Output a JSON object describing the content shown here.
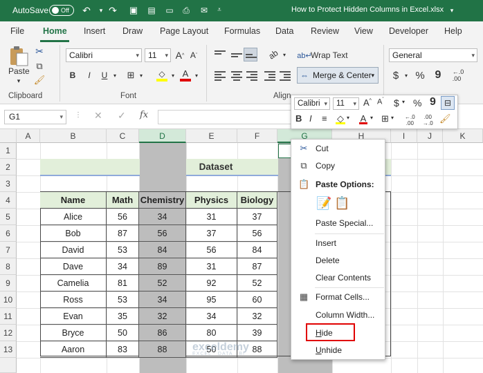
{
  "title_bar": {
    "autosave_label": "AutoSave",
    "autosave_state": "Off",
    "document_title": "How to Protect Hidden Columns in Excel.xlsx"
  },
  "menu_tabs": [
    "File",
    "Home",
    "Insert",
    "Draw",
    "Page Layout",
    "Formulas",
    "Data",
    "Review",
    "View",
    "Developer",
    "Help"
  ],
  "ribbon": {
    "paste_label": "Paste",
    "clipboard_group": "Clipboard",
    "font_group": "Font",
    "alignment_group": "Align",
    "font_name": "Calibri",
    "font_size": "11",
    "wrap_text": "Wrap Text",
    "merge_center": "Merge & Center",
    "number_format": "General",
    "bold": "B",
    "italic": "I",
    "underline": "U",
    "currency": "$",
    "percent": "%",
    "comma": "9"
  },
  "formula_bar": {
    "name_box": "G1",
    "fx": "fx"
  },
  "mini_toolbar": {
    "font_name": "Calibri",
    "font_size": "11"
  },
  "sheet": {
    "columns": [
      "A",
      "B",
      "C",
      "D",
      "E",
      "F",
      "G",
      "H",
      "I",
      "J",
      "K"
    ],
    "rows": [
      "1",
      "2",
      "3",
      "4",
      "5",
      "6",
      "7",
      "8",
      "9",
      "10",
      "11",
      "12",
      "13"
    ],
    "dataset_title": "Dataset",
    "headers": [
      "Name",
      "Math",
      "Chemistry",
      "Physics",
      "Biology"
    ],
    "records": [
      [
        "Alice",
        "56",
        "34",
        "31",
        "37"
      ],
      [
        "Bob",
        "87",
        "56",
        "37",
        "56"
      ],
      [
        "David",
        "53",
        "84",
        "56",
        "84"
      ],
      [
        "Dave",
        "34",
        "89",
        "31",
        "87"
      ],
      [
        "Camelia",
        "81",
        "52",
        "92",
        "52"
      ],
      [
        "Ross",
        "53",
        "34",
        "95",
        "60"
      ],
      [
        "Evan",
        "35",
        "32",
        "34",
        "32"
      ],
      [
        "Bryce",
        "50",
        "86",
        "80",
        "39"
      ],
      [
        "Aaron",
        "83",
        "88",
        "50",
        "88"
      ]
    ]
  },
  "context_menu": {
    "cut": "Cut",
    "copy": "Copy",
    "paste_options": "Paste Options:",
    "paste_special": "Paste Special...",
    "insert": "Insert",
    "delete": "Delete",
    "clear_contents": "Clear Contents",
    "format_cells": "Format Cells...",
    "column_width": "Column Width...",
    "hide": "Hide",
    "unhide": "Unhide"
  },
  "watermark": {
    "brand": "exceldemy",
    "tagline": "EXCEL · DATA · BI"
  },
  "colors": {
    "excel_green": "#217346",
    "header_fill": "#e2efda",
    "selection_gray": "#bdbdbd",
    "highlight_red": "#e00000"
  }
}
